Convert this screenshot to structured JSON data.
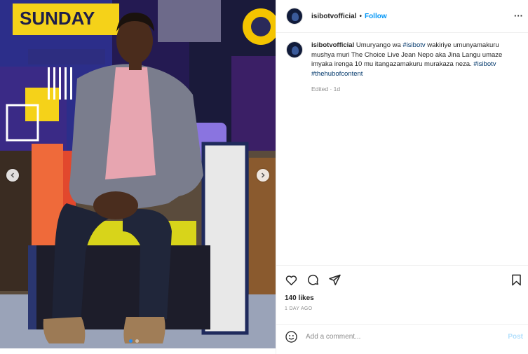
{
  "post": {
    "username": "isibotvofficial",
    "separator": "•",
    "follow_label": "Follow",
    "more_label": "···",
    "caption": {
      "username": "isibotvofficial",
      "text_1": " Umuryango wa ",
      "tag_1": "#isibotv",
      "text_2": " wakiriye umunyamakuru mushya muri The Choice Live Jean Nepo aka Jina Langu umaze imyaka irenga 10 mu itangazamakuru murakaza neza. ",
      "tag_2": "#isibotv",
      "tag_3": "#thehubofcontent"
    },
    "edited": "Edited · 1d",
    "likes": "140 likes",
    "date": "1 DAY AGO",
    "comment_placeholder": "Add a comment...",
    "post_label": "Post"
  },
  "media": {
    "studio_sign_text": "SUNDAY",
    "carousel": {
      "count": 2,
      "active_index": 0
    }
  },
  "icons": {
    "like": "heart-icon",
    "comment": "comment-icon",
    "share": "share-icon",
    "save": "bookmark-icon",
    "emoji": "emoji-icon",
    "prev": "chevron-left-icon",
    "next": "chevron-right-icon"
  },
  "colors": {
    "follow": "#0095f6",
    "hashtag": "#00376b",
    "secondary_text": "#8e8e8e",
    "post_disabled": "#b2dffc"
  }
}
